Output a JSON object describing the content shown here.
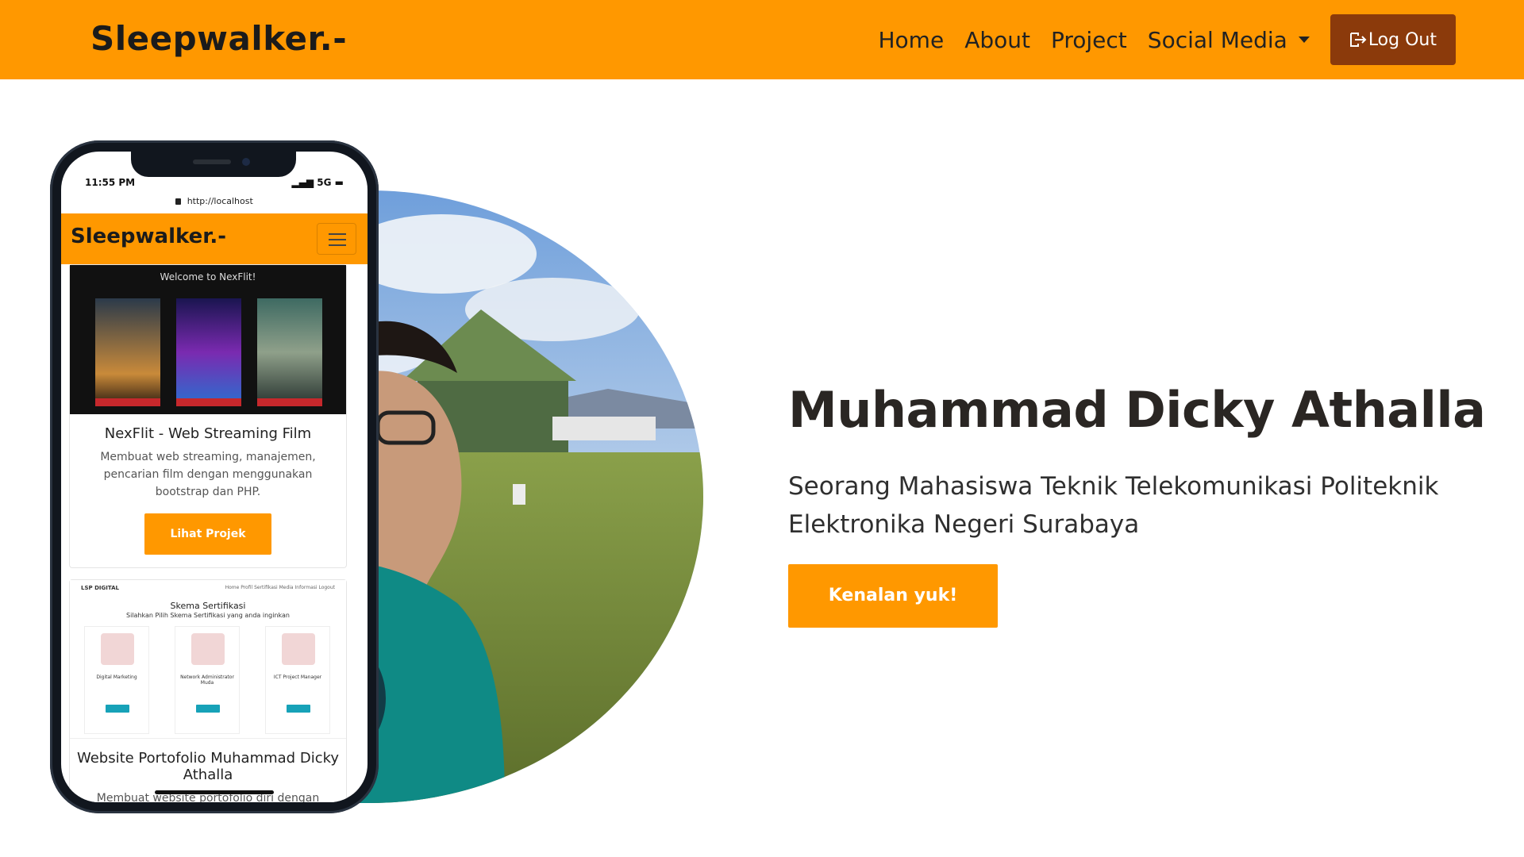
{
  "navbar": {
    "brand": "Sleepwalker.-",
    "links": [
      "Home",
      "About",
      "Project",
      "Social Media"
    ],
    "logout_label": "Log Out",
    "bg_color": "#ff9800",
    "logout_color": "#8b3a0b"
  },
  "phone": {
    "time": "11:55 PM",
    "network": "5G",
    "url": "http://localhost",
    "brand": "Sleepwalker.-",
    "cards": [
      {
        "banner_text": "Welcome to NexFlit!",
        "title": "NexFlit - Web Streaming Film",
        "description": "Membuat web streaming, manajemen, pencarian film dengan menggunakan bootstrap dan PHP.",
        "button": "Lihat Projek"
      },
      {
        "header_logo": "LSP DIGITAL",
        "header_menu": "Home  Profil  Sertifikasi  Media  Informasi  Logout",
        "schema_title": "Skema Sertifikasi",
        "schema_subtitle": "Silahkan Pilih Skema Sertifikasi yang anda inginkan",
        "schemas": [
          "Digital Marketing",
          "Network Administrator Muda",
          "ICT Project Manager"
        ],
        "title": "Website Portofolio Muhammad Dicky Athalla",
        "description": "Membuat website portofolio diri dengan"
      }
    ]
  },
  "hero": {
    "title": "Muhammad Dicky Athalla",
    "subtitle": "Seorang Mahasiswa Teknik Telekomunikasi Politeknik Elektronika Negeri Surabaya",
    "button": "Kenalan yuk!"
  },
  "icons": {
    "logout": "logout-icon",
    "dropdown": "caret-down-icon",
    "menu": "hamburger-icon",
    "lock": "lock-icon"
  }
}
